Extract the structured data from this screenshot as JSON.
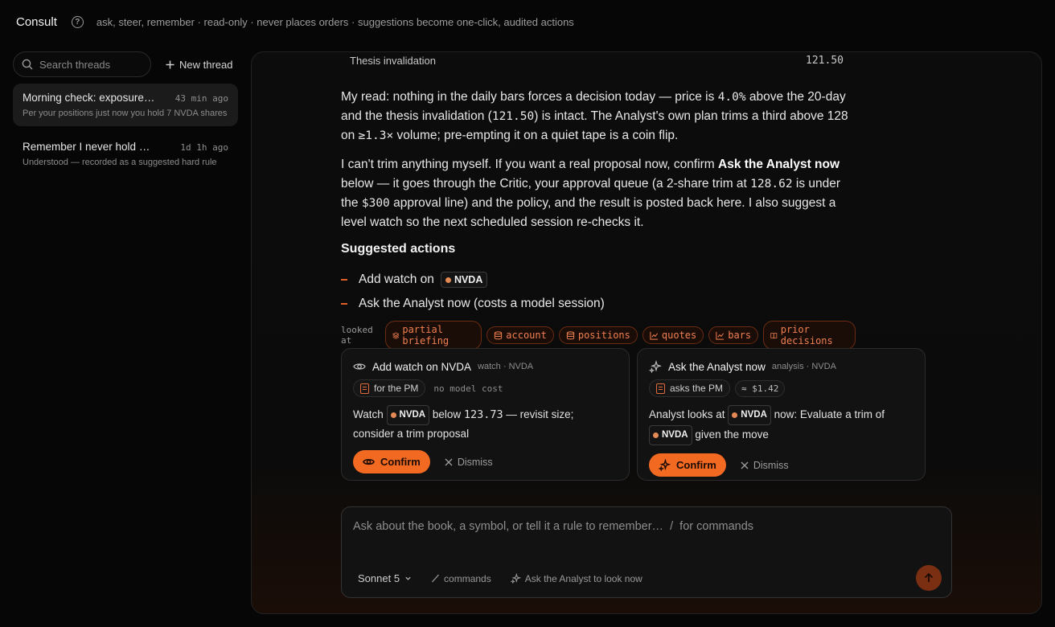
{
  "header": {
    "app_title": "Consult",
    "tagline": "ask, steer, remember · read-only · never places orders · suggestions become one-click, audited actions"
  },
  "sidebar": {
    "search_placeholder": "Search threads",
    "new_thread_label": "New thread",
    "threads": [
      {
        "title": "Morning check: exposure, NVDA",
        "time": "43 min ago",
        "snippet": "Per your positions just now you hold 7 NVDA shares",
        "active": true
      },
      {
        "title": "Remember I never hold NVDA",
        "time": "1d 1h ago",
        "snippet": "Understood — recorded as a suggested hard rule",
        "active": false
      }
    ]
  },
  "conversation": {
    "invalidation_row": {
      "label": "Thesis invalidation",
      "value": "121.50"
    },
    "para1": {
      "t1": "My read: nothing in the daily bars forces a decision today — price is ",
      "pct": "4.0%",
      "t2": " above the 20-day and the thesis invalidation (",
      "inv": "121.50",
      "t3": ") is intact. The Analyst's own plan trims a third above 128 on ",
      "vol": "≥1.3×",
      "t4": " volume; pre-empting it on a quiet tape is a coin flip."
    },
    "para2": {
      "t1": "I can't trim anything myself. If you want a real proposal now, confirm ",
      "bold": "Ask the Analyst now",
      "t2": " below — it goes through the Critic, your approval queue (a 2-share trim at ",
      "price": "128.62",
      "t3": " is under the ",
      "limit": "$300",
      "t4": " approval line) and the policy, and the result is posted back here. I also suggest a level watch so the next scheduled session re-checks it."
    },
    "suggested_heading": "Suggested actions",
    "actions": {
      "a1_text": "Add watch on",
      "a1_ticker": "NVDA",
      "a2_text": "Ask the Analyst now (costs a model session)"
    },
    "looked_at_label": "looked at",
    "sources": [
      "partial briefing",
      "account",
      "positions",
      "quotes",
      "bars",
      "prior decisions"
    ]
  },
  "cards": [
    {
      "title": "Add watch on NVDA",
      "meta": "watch · NVDA",
      "audience": "for the PM",
      "cost": "no model cost",
      "body_t1": "Watch ",
      "body_ticker": "NVDA",
      "body_t2": " below ",
      "body_level": "123.73",
      "body_t3": " — revisit size; consider a trim proposal",
      "confirm": "Confirm",
      "dismiss": "Dismiss"
    },
    {
      "title": "Ask the Analyst now",
      "meta": "analysis · NVDA",
      "audience": "asks the PM",
      "cost": "≈ $1.42",
      "body_t1": "Analyst looks at ",
      "body_ticker": "NVDA",
      "body_t2": " now: Evaluate a trim of ",
      "body_ticker2": "NVDA",
      "body_t3": " given the move",
      "confirm": "Confirm",
      "dismiss": "Dismiss"
    }
  ],
  "composer": {
    "placeholder": "Ask about the book, a symbol, or tell it a rule to remember…  /  for commands",
    "model": "Sonnet 5",
    "commands_label": "commands",
    "ask_analyst_label": "Ask the Analyst to look now"
  },
  "colors": {
    "accent": "#f26a22",
    "chip_text": "#f08050",
    "ticker_dot": "#e48a55"
  }
}
